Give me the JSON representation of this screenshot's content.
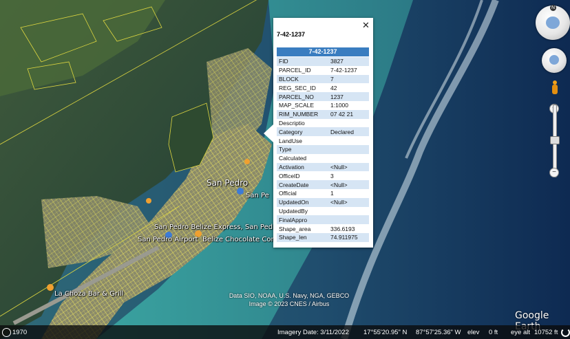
{
  "map": {
    "places": [
      {
        "label": "San Pedro",
        "cls": "big"
      },
      {
        "label": "San Pe",
        "cls": "sm"
      },
      {
        "label": "San Pedro Belize Express, San Ped",
        "cls": "sm"
      },
      {
        "label": "San Pedro Airport",
        "cls": "sm"
      },
      {
        "label": "Belize Chocolate Com",
        "cls": "sm"
      },
      {
        "label": "La Choza Bar & Grill",
        "cls": "sm"
      }
    ],
    "attribution_line1": "Data SIO, NOAA, U.S. Navy, NGA, GEBCO",
    "attribution_line2": "Image © 2023 CNES / Airbus",
    "logo": "Google Earth",
    "colors": {
      "parcel_lines": "#f0e020",
      "popup_header": "#3a7dc0",
      "row_alt": "#d6e5f4"
    }
  },
  "popup": {
    "title": "7-42-1237",
    "header": "7-42-1237",
    "close_icon": "close-icon",
    "rows": [
      {
        "key": "FID",
        "value": "3827"
      },
      {
        "key": "PARCEL_ID",
        "value": "7-42-1237"
      },
      {
        "key": "BLOCK",
        "value": "7"
      },
      {
        "key": "REG_SEC_ID",
        "value": "42"
      },
      {
        "key": "PARCEL_NO",
        "value": "1237"
      },
      {
        "key": "MAP_SCALE",
        "value": "1:1000"
      },
      {
        "key": "RIM_NUMBER",
        "value": "07 42 21"
      },
      {
        "key": "Descriptio",
        "value": ""
      },
      {
        "key": "Category",
        "value": "Declared"
      },
      {
        "key": "LandUse",
        "value": ""
      },
      {
        "key": "Type",
        "value": ""
      },
      {
        "key": "Calculated",
        "value": ""
      },
      {
        "key": "Activation",
        "value": "<Null>"
      },
      {
        "key": "OfficeID",
        "value": "3"
      },
      {
        "key": "CreateDate",
        "value": "<Null>"
      },
      {
        "key": "Official",
        "value": "1"
      },
      {
        "key": "UpdatedOn",
        "value": "<Null>"
      },
      {
        "key": "UpdatedBy",
        "value": ""
      },
      {
        "key": "FinalAppro",
        "value": ""
      },
      {
        "key": "Shape_area",
        "value": "336.6193"
      },
      {
        "key": "Shape_len",
        "value": "74.911975"
      }
    ]
  },
  "nav": {
    "north": "N",
    "zoom_in": "+",
    "zoom_out": "−"
  },
  "status": {
    "year": "1970",
    "imagery_date": "Imagery Date: 3/11/2022",
    "lat": "17°55'20.95\" N",
    "lon": "87°57'25.36\" W",
    "elev_label": "elev",
    "elev_value": "0 ft",
    "eye_alt_label": "eye alt",
    "eye_alt_value": "10752 ft"
  }
}
